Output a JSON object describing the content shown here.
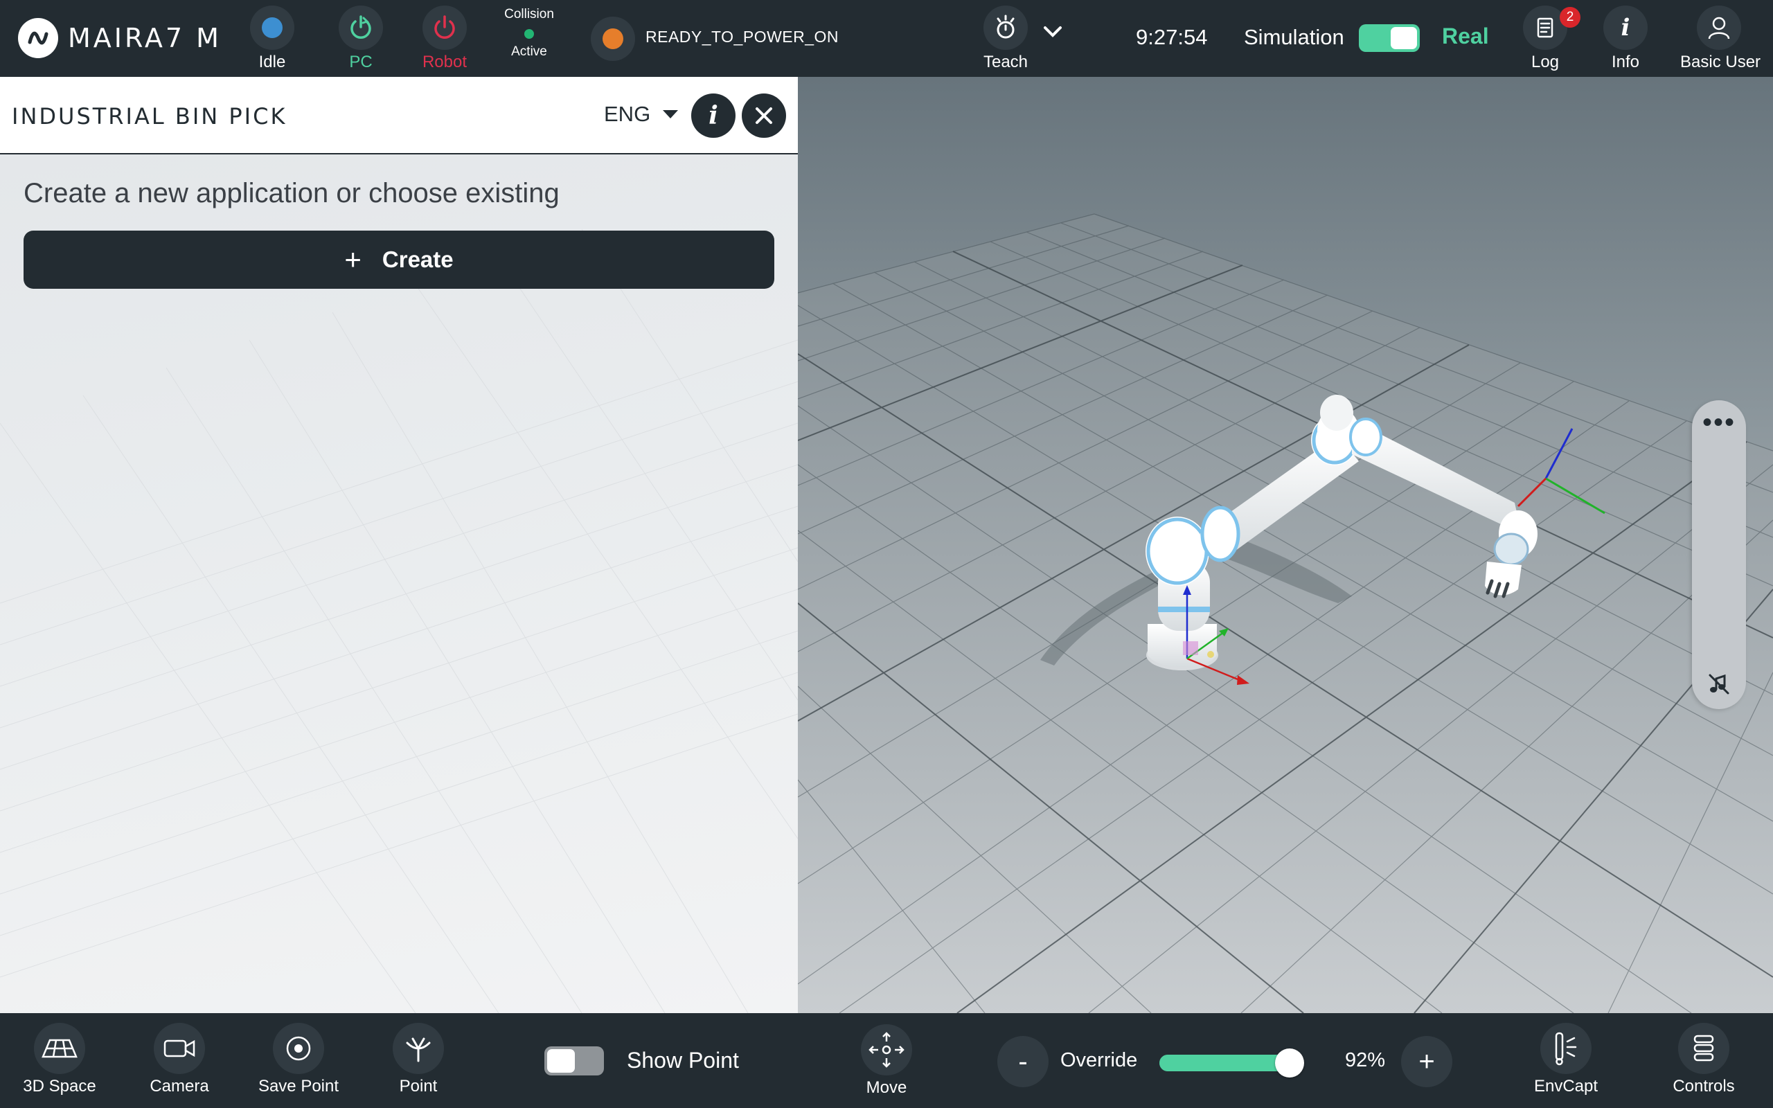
{
  "brand": {
    "name": "MAIRA7 M"
  },
  "topbar": {
    "idle_label": "Idle",
    "pc_label": "PC",
    "robot_label": "Robot",
    "collision_title": "Collision",
    "collision_state": "Active",
    "robot_state": "READY_TO_POWER_ON",
    "teach_label": "Teach",
    "time": "9:27:54",
    "simulation_label": "Simulation",
    "real_label": "Real",
    "log_label": "Log",
    "log_badge": "2",
    "info_label": "Info",
    "user_label": "Basic User",
    "colors": {
      "idle": "#3d8fd1",
      "pc": "#4fd1a0",
      "robot": "#e0314d",
      "status": "#e67e2b",
      "accent": "#4fd1a0"
    }
  },
  "panel": {
    "title": "INDUSTRIAL BIN PICK",
    "language": "ENG",
    "prompt": "Create a new application or choose existing",
    "create_label": "Create"
  },
  "bottombar": {
    "space_label": "3D Space",
    "camera_label": "Camera",
    "save_point_label": "Save Point",
    "point_label": "Point",
    "show_point_label": "Show Point",
    "move_label": "Move",
    "minus_label": "-",
    "override_label": "Override",
    "override_value": "92%",
    "override_fraction": 0.92,
    "plus_label": "+",
    "envcapt_label": "EnvCapt",
    "controls_label": "Controls"
  }
}
